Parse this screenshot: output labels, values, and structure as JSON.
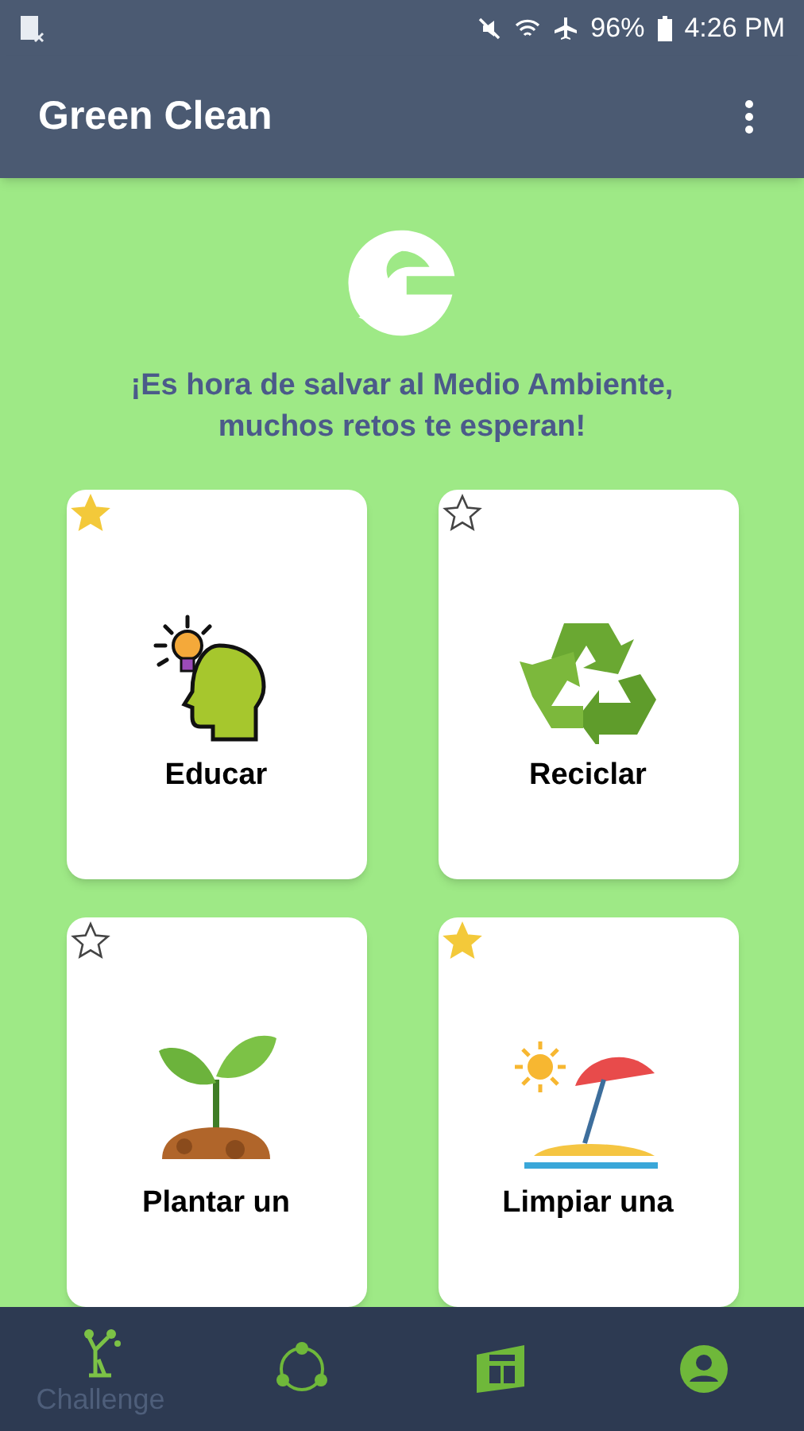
{
  "status_bar": {
    "battery": "96%",
    "time": "4:26 PM"
  },
  "app_bar": {
    "title": "Green Clean"
  },
  "intro": "¡Es hora de salvar al Medio Ambiente, muchos retos te esperan!",
  "cards": [
    {
      "kind": "educate",
      "label": "Educar",
      "favorite": true
    },
    {
      "kind": "recycle",
      "label": "Reciclar",
      "favorite": false
    },
    {
      "kind": "plant",
      "label": "Plantar un",
      "favorite": false
    },
    {
      "kind": "beach",
      "label": "Limpiar una",
      "favorite": true
    }
  ],
  "bottom_nav": [
    {
      "kind": "challenge",
      "label": "Challenge",
      "selected": true
    },
    {
      "kind": "share",
      "selected": false
    },
    {
      "kind": "news",
      "selected": false
    },
    {
      "kind": "profile",
      "selected": false
    }
  ]
}
